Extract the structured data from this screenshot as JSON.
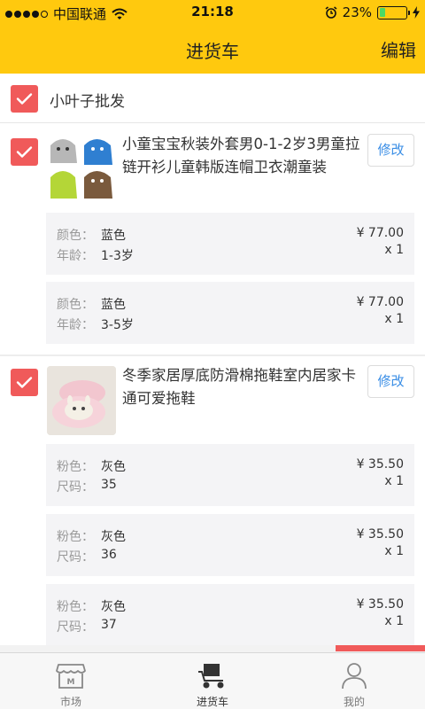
{
  "status_bar": {
    "carrier": "中国联通",
    "time": "21:18",
    "battery_percent": "23%",
    "battery_level": 0.23,
    "signal_bars": 4,
    "signal_total": 5
  },
  "nav": {
    "title": "进货车",
    "edit_label": "编辑"
  },
  "shop": {
    "name": "小叶子批发",
    "checked": true
  },
  "products": [
    {
      "title": "小童宝宝秋装外套男0-1-2岁3男童拉链开衫儿童韩版连帽卫衣潮童装",
      "edit_label": "修改",
      "checked": true,
      "thumbnail_icon": "hoodie-thumbnail-icon",
      "variants": [
        {
          "attr1_key": "颜色：",
          "attr1_val": "蓝色",
          "attr2_key": "年龄：",
          "attr2_val": "1-3岁",
          "price": "¥ 77.00",
          "qty": "x 1"
        },
        {
          "attr1_key": "颜色：",
          "attr1_val": "蓝色",
          "attr2_key": "年龄：",
          "attr2_val": "3-5岁",
          "price": "¥ 77.00",
          "qty": "x 1"
        }
      ]
    },
    {
      "title": "冬季家居厚底防滑棉拖鞋室内居家卡通可爱拖鞋",
      "edit_label": "修改",
      "checked": true,
      "thumbnail_icon": "slipper-thumbnail-icon",
      "variants": [
        {
          "attr1_key": "粉色：",
          "attr1_val": "灰色",
          "attr2_key": "尺码：",
          "attr2_val": "35",
          "price": "¥ 35.50",
          "qty": "x 1"
        },
        {
          "attr1_key": "粉色：",
          "attr1_val": "灰色",
          "attr2_key": "尺码：",
          "attr2_val": "36",
          "price": "¥ 35.50",
          "qty": "x 1"
        },
        {
          "attr1_key": "粉色：",
          "attr1_val": "灰色",
          "attr2_key": "尺码：",
          "attr2_val": "37",
          "price": "¥ 35.50",
          "qty": "x 1"
        }
      ]
    }
  ],
  "scroll_progress": 0.21,
  "tabbar": {
    "tabs": [
      {
        "label": "市场",
        "icon": "market-icon",
        "active": false
      },
      {
        "label": "进货车",
        "icon": "cart-icon",
        "active": true
      },
      {
        "label": "我的",
        "icon": "user-icon",
        "active": false
      }
    ]
  },
  "colors": {
    "header": "#ffc90e",
    "accent_red": "#f05a5a",
    "link_blue": "#3a8ee6"
  }
}
